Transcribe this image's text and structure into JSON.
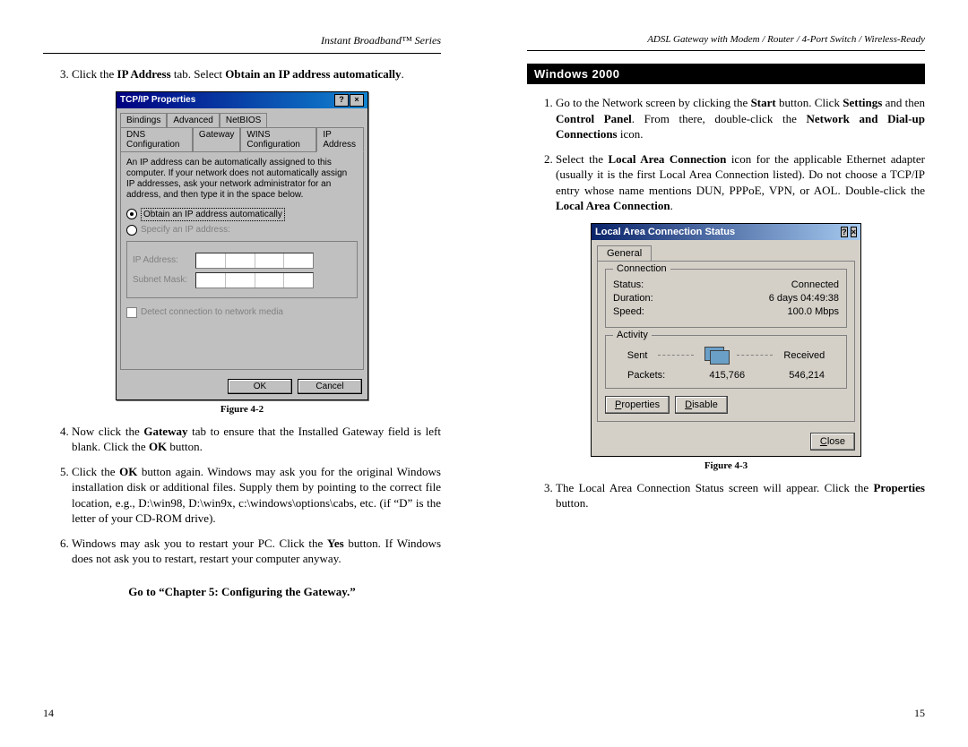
{
  "left": {
    "header": "Instant Broadband™ Series",
    "step3_pre": "Click the ",
    "step3_b1": "IP Address",
    "step3_mid": " tab. Select ",
    "step3_b2": "Obtain an IP address automatically",
    "step3_post": ".",
    "fig42_caption": "Figure 4-2",
    "step4_a": "Now click the ",
    "step4_b": "Gateway",
    "step4_c": " tab to ensure that the Installed Gateway field is left blank. Click the ",
    "step4_d": "OK",
    "step4_e": " button.",
    "step5_a": "Click the ",
    "step5_b": "OK",
    "step5_c": " button again.  Windows may ask you for the original Windows installation disk or additional files. Supply them by pointing to the correct file location, e.g., D:\\win98, D:\\win9x, c:\\windows\\options\\cabs, etc. (if “D” is the letter of your CD-ROM drive).",
    "step6_a": "Windows may ask you to restart your PC. Click the ",
    "step6_b": "Yes",
    "step6_c": " button. If Windows does not ask you to restart, restart your computer anyway.",
    "go_link": "Go to “Chapter 5: Configuring the Gateway.”",
    "pagenum": "14"
  },
  "dlg9x": {
    "title": "TCP/IP Properties",
    "help_btn": "?",
    "close_btn": "×",
    "tabs_row1": [
      "Bindings",
      "Advanced",
      "NetBIOS"
    ],
    "tabs_row2": [
      "DNS Configuration",
      "Gateway",
      "WINS Configuration",
      "IP Address"
    ],
    "info": "An IP address can be automatically assigned to this computer. If your network does not automatically assign IP addresses, ask your network administrator for an address, and then type it in the space below.",
    "opt_auto": "Obtain an IP address automatically",
    "opt_spec": "Specify an IP address:",
    "ip_label": "IP Address:",
    "mask_label": "Subnet Mask:",
    "detect": "Detect connection to network media",
    "ok": "OK",
    "cancel": "Cancel"
  },
  "right": {
    "header": "ADSL Gateway with Modem / Router / 4-Port Switch / Wireless-Ready",
    "section": "Windows 2000",
    "s1_a": "Go to the Network screen by clicking the ",
    "s1_b": "Start",
    "s1_c": " button. Click ",
    "s1_d": "Settings",
    "s1_e": " and then ",
    "s1_f": "Control Panel",
    "s1_g": ".  From there, double-click the ",
    "s1_h": "Network and Dial-up Connections",
    "s1_i": " icon.",
    "s2_a": "Select the ",
    "s2_b": "Local Area Connection",
    "s2_c": " icon for the applicable Ethernet adapter (usually it is the first Local Area Connection listed). Do not choose a TCP/IP entry whose name mentions DUN, PPPoE, VPN, or AOL. Double-click the ",
    "s2_d": "Local Area Connection",
    "s2_e": ".",
    "fig43_caption": "Figure 4-3",
    "s3_a": "The Local Area Connection Status screen will appear. Click the ",
    "s3_b": "Properties",
    "s3_c": " button.",
    "pagenum": "15"
  },
  "dlg2k": {
    "title": "Local Area Connection Status",
    "help_btn": "?",
    "close_btn": "×",
    "tab": "General",
    "conn_legend": "Connection",
    "status_l": "Status:",
    "status_v": "Connected",
    "dur_l": "Duration:",
    "dur_v": "6 days 04:49:38",
    "speed_l": "Speed:",
    "speed_v": "100.0 Mbps",
    "act_legend": "Activity",
    "sent": "Sent",
    "recv": "Received",
    "pkts_l": "Packets:",
    "pkts_sent": "415,766",
    "pkts_recv": "546,214",
    "btn_props": "Properties",
    "btn_disable": "Disable",
    "btn_close": "Close"
  },
  "chart_data": null
}
